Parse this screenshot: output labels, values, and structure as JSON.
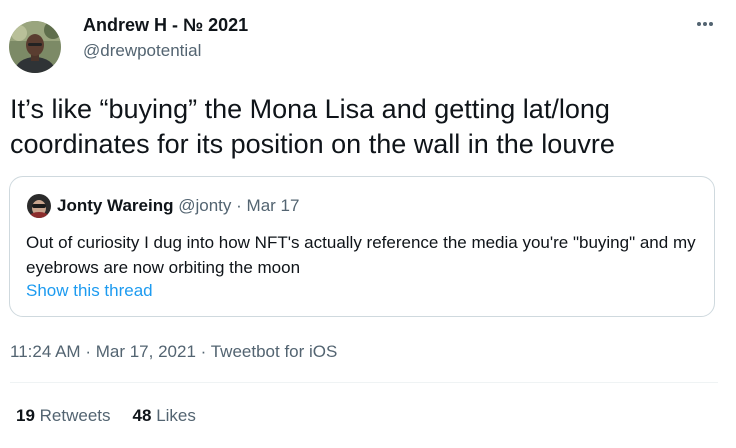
{
  "author": {
    "name": "Andrew H - № 2021",
    "handle": "@drewpotential"
  },
  "tweet": {
    "text": "It’s like “buying” the Mona Lisa and getting lat/long coordinates for its position on the wall in the louvre"
  },
  "quoted_tweet": {
    "name": "Jonty Wareing",
    "handle": "@jonty",
    "separator": "·",
    "date": "Mar 17",
    "text": "Out of curiosity I dug into how NFT's actually reference the media you're \"buying\" and my eyebrows are now orbiting the moon",
    "link_label": "Show this thread"
  },
  "meta": {
    "time": "11:24 AM",
    "date": "Mar 17, 2021",
    "source": "Tweetbot for iOS",
    "separator": "·"
  },
  "stats": {
    "retweets_count": "19",
    "retweets_label": "Retweets",
    "likes_count": "48",
    "likes_label": "Likes"
  },
  "icons": {
    "more": "more-horizontal-icon"
  },
  "colors": {
    "primary_text": "#0f1419",
    "secondary_text": "#536471",
    "link": "#1d9bf0",
    "border": "#cfd9de"
  }
}
